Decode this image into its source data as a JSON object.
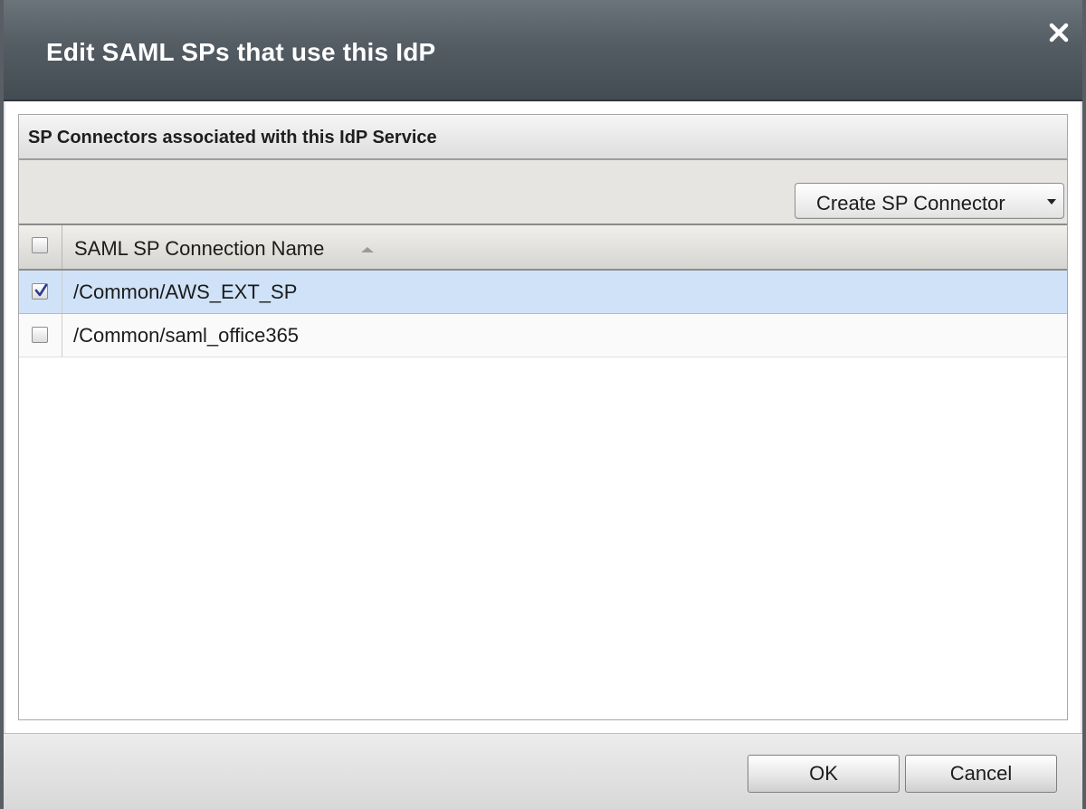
{
  "dialog": {
    "title": "Edit SAML SPs that use this IdP"
  },
  "panel": {
    "title": "SP Connectors associated with this IdP Service",
    "create_button_label": "Create SP Connector"
  },
  "table": {
    "column_name_header": "SAML SP Connection Name",
    "sort": "ascending",
    "rows": [
      {
        "name": "/Common/AWS_EXT_SP",
        "checked": true,
        "selected": true
      },
      {
        "name": "/Common/saml_office365",
        "checked": false,
        "selected": false
      }
    ]
  },
  "footer": {
    "ok_label": "OK",
    "cancel_label": "Cancel"
  },
  "colors": {
    "titlebar": "#545c64",
    "selected_row": "#cfe2f8",
    "checkmark": "#2b3a8f"
  }
}
